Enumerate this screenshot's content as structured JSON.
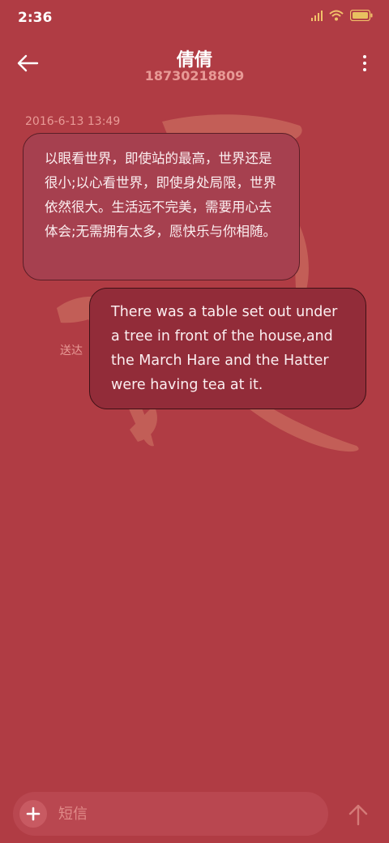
{
  "status_bar": {
    "time": "2:36",
    "icons": [
      "signal-icon",
      "wifi-icon",
      "battery-icon"
    ],
    "signal_color": "#f2c26a",
    "battery_color": "#e8c060"
  },
  "header": {
    "contact_name": "倩倩",
    "contact_number": "18730218809",
    "back_icon": "back-arrow-icon",
    "more_icon": "more-vertical-icon"
  },
  "conversation": {
    "timestamp": "2016-6-13 13:49",
    "messages": [
      {
        "direction": "received",
        "text": "以眼看世界，即使站的最高，世界还是很小;以心看世界，即使身处局限，世界依然很大。生活远不完美，需要用心去体会;无需拥有太多，愿快乐与你相随。"
      },
      {
        "direction": "sent",
        "text": "There was a table set out under a tree in front of the house,and the March Hare and the Hatter were having tea at it.",
        "status": "送达"
      }
    ]
  },
  "composer": {
    "placeholder": "短信",
    "add_icon": "plus-icon",
    "send_icon": "send-arrow-icon"
  },
  "colors": {
    "background": "#b03c44",
    "received_bubble": "#a6404f",
    "sent_bubble": "#922c39",
    "muted_text": "#e89a96"
  }
}
